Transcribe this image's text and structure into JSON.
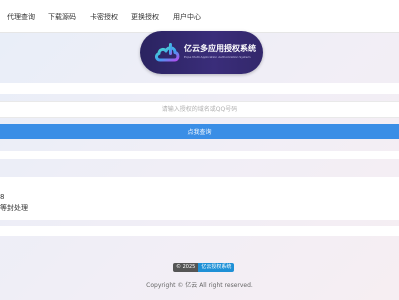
{
  "nav": {
    "items": [
      {
        "label": "代理查询"
      },
      {
        "label": "下载源码"
      },
      {
        "label": "卡密授权"
      },
      {
        "label": "更换授权"
      },
      {
        "label": "用户中心"
      }
    ]
  },
  "logo": {
    "title": "亿云多应用授权系统",
    "subtitle": "Ecpe Multi Application Authorization System"
  },
  "search": {
    "placeholder": "请输入授权的域名或QQ号码"
  },
  "query_button": {
    "label": "点我查询"
  },
  "result": {
    "line1": "8",
    "line2": "等封处理"
  },
  "footer": {
    "badge_left": "© 2025",
    "badge_right": "亿云授权系统",
    "copyright": "Copyright © 亿云 All right reserved."
  },
  "colors": {
    "accent": "#3a8ee6",
    "logo_bg": "#2a2360",
    "badge_right": "#1e90d6"
  }
}
